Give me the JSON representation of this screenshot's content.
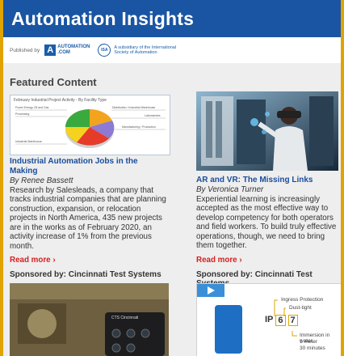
{
  "header": {
    "title": "Automation Insights"
  },
  "publisher": {
    "published_by": "Published by",
    "automation_logo_line1": "AUTOMATION",
    "automation_logo_line2": ".COM",
    "isa_logo": "ISA",
    "isa_tagline": "A subsidiary of the International Society of Automation"
  },
  "featured": {
    "title": "Featured Content",
    "cards": [
      {
        "title": "Industrial Automation Jobs in the Making",
        "author": "By Renee Bassett",
        "body": "Research by Salesleads, a company that tracks industrial companies that are planning construction, expansion, or relocation projects in North America, 435 new projects are in the works as of February 2020, an activity increase of 1% from the previous month.",
        "read_more": "Read more ›",
        "thumb_caption": "February Industrial Project Activity - By Facility Type",
        "thumb_labels": [
          "Power Energy Oil and Gas",
          "Distribution / Industrial Warehouse",
          "Processing",
          "Laboratories",
          "Manufacturing / Production",
          "Industrial Warehouse"
        ]
      },
      {
        "title": "AR and VR: The Missing Links",
        "author": "By Veronica Turner",
        "body": "Experiential learning is increasingly accepted as the most effective way to develop competency for both operators and field workers. To build truly effective operations, though, we need to bring them together.",
        "read_more": "Read more ›"
      }
    ]
  },
  "sponsored": [
    {
      "label": "Sponsored by: Cincinnati Test Systems",
      "device_brand": "CTS Cincinnati"
    },
    {
      "label": "Sponsored by: Cincinnati Test Systems",
      "ip_rating": [
        "IP",
        "6",
        "7"
      ],
      "ingress": "Ingress Protection",
      "dust": "Dust-tight",
      "immersion": "Immersion in water",
      "meter": "1 meter",
      "minutes": "30 minutes"
    }
  ],
  "colors": {
    "header_bg": "#1a55a3",
    "title_blue": "#1a4d9c",
    "link_red": "#d62020",
    "outer_border": "#e1a300"
  }
}
